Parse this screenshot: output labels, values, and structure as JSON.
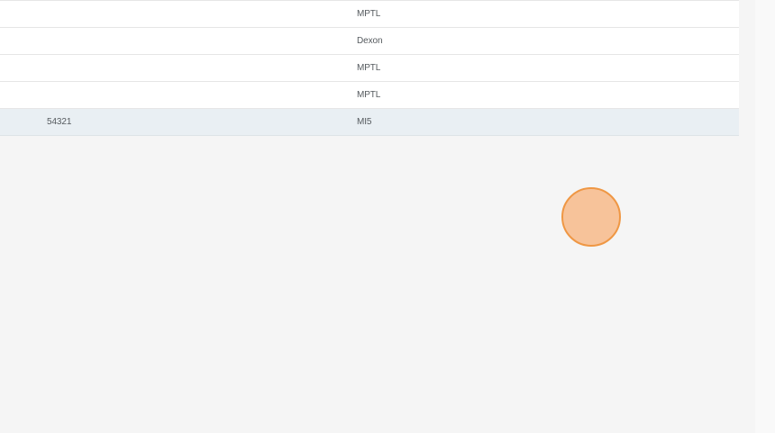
{
  "table": {
    "rows": [
      {
        "id": "",
        "org": "MPTL",
        "selected": false
      },
      {
        "id": "",
        "org": "Dexon",
        "selected": false
      },
      {
        "id": "",
        "org": "MPTL",
        "selected": false
      },
      {
        "id": "",
        "org": "MPTL",
        "selected": false
      },
      {
        "id": "54321",
        "org": "MI5",
        "selected": true
      }
    ]
  },
  "colors": {
    "selected_row": "#e9eff3",
    "click_indicator_fill": "#f7c39a",
    "click_indicator_border": "#ef9744"
  }
}
